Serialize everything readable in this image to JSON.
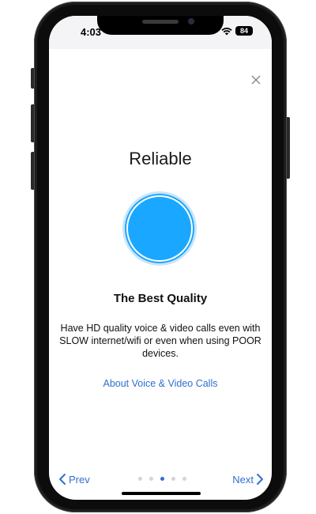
{
  "status_bar": {
    "time": "4:03",
    "battery": "84",
    "icons": [
      "cellular-signal-icon",
      "wifi-icon",
      "battery-icon"
    ]
  },
  "onboarding": {
    "close_icon": "close-icon",
    "title": "Reliable",
    "hero_icon": "blue-circle-icon",
    "subtitle": "The Best Quality",
    "description": "Have HD quality voice & video calls even with SLOW internet/wifi or even when using POOR devices.",
    "link_label": "About Voice & Video Calls"
  },
  "navigation": {
    "prev_label": "Prev",
    "next_label": "Next",
    "page_count": 5,
    "active_page": 3
  },
  "colors": {
    "accent": "#2F6FD1",
    "circle_fill": "#1AA7FF",
    "circle_ring": "#A9D6F5"
  }
}
